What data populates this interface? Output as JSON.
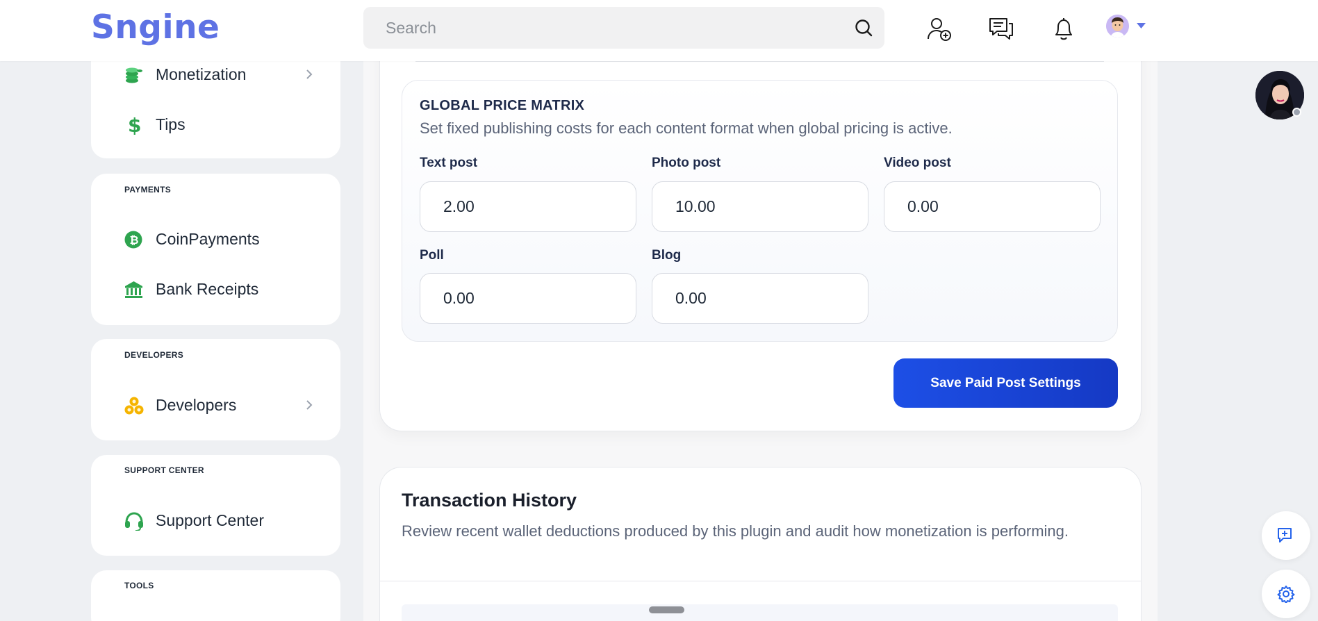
{
  "header": {
    "logo": "Sngine",
    "search_placeholder": "Search"
  },
  "sidebar": {
    "monetization_card": {
      "items": [
        {
          "label": "Monetization",
          "icon": "coins-icon",
          "has_chevron": true
        },
        {
          "label": "Tips",
          "icon": "dollar-icon",
          "has_chevron": false
        }
      ]
    },
    "payments": {
      "title": "PAYMENTS",
      "items": [
        {
          "label": "CoinPayments",
          "icon": "bitcoin-icon"
        },
        {
          "label": "Bank Receipts",
          "icon": "bank-icon"
        }
      ]
    },
    "developers": {
      "title": "DEVELOPERS",
      "items": [
        {
          "label": "Developers",
          "icon": "developers-icon",
          "has_chevron": true
        }
      ]
    },
    "support": {
      "title": "SUPPORT CENTER",
      "items": [
        {
          "label": "Support Center",
          "icon": "headset-icon"
        }
      ]
    },
    "tools": {
      "title": "TOOLS"
    }
  },
  "matrix": {
    "title": "GLOBAL PRICE MATRIX",
    "subtitle": "Set fixed publishing costs for each content format when global pricing is active.",
    "fields": [
      {
        "label": "Text post",
        "value": "2.00"
      },
      {
        "label": "Photo post",
        "value": "10.00"
      },
      {
        "label": "Video post",
        "value": "0.00"
      },
      {
        "label": "Poll",
        "value": "0.00"
      },
      {
        "label": "Blog",
        "value": "0.00"
      }
    ]
  },
  "save_button": "Save Paid Post Settings",
  "transactions": {
    "title": "Transaction History",
    "subtitle": "Review recent wallet deductions produced by this plugin and audit how monetization is performing."
  },
  "colors": {
    "brand": "#5e72e4",
    "primary_button": "#1d4fe6",
    "icon_green": "#2ea44f",
    "icon_yellow": "#f5b400",
    "fab_blue": "#2563eb"
  }
}
